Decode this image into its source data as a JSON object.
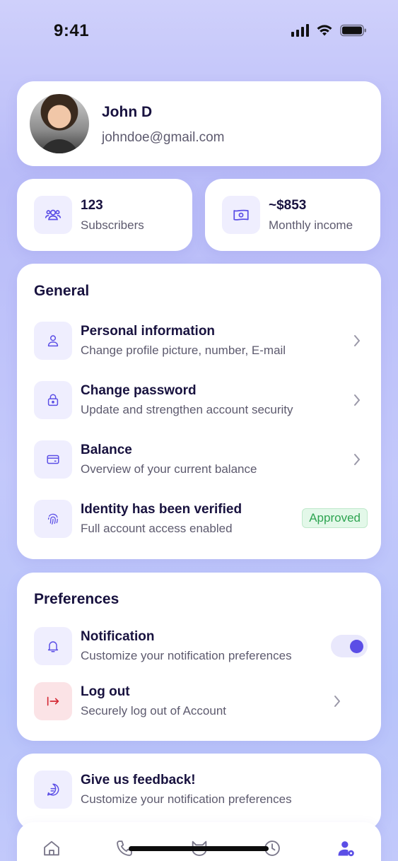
{
  "status_bar": {
    "time": "9:41"
  },
  "profile": {
    "name": "John D",
    "email": "johndoe@gmail.com"
  },
  "stats": [
    {
      "value": "123",
      "label": "Subscribers",
      "icon": "users-icon"
    },
    {
      "value": "~$853",
      "label": "Monthly income",
      "icon": "money-icon"
    }
  ],
  "general": {
    "title": "General",
    "items": [
      {
        "title": "Personal information",
        "subtitle": "Change profile picture, number, E-mail",
        "icon": "user-icon"
      },
      {
        "title": "Change password",
        "subtitle": "Update and strengthen account security",
        "icon": "lock-icon"
      },
      {
        "title": "Balance",
        "subtitle": "Overview of your current balance",
        "icon": "wallet-icon"
      },
      {
        "title": "Identity has been verified",
        "subtitle": "Full account access enabled",
        "icon": "fingerprint-icon",
        "badge": "Approved"
      }
    ]
  },
  "preferences": {
    "title": "Preferences",
    "items": [
      {
        "title": "Notification",
        "subtitle": "Customize your notification preferences",
        "icon": "bell-icon",
        "toggle_on": true
      },
      {
        "title": "Log out",
        "subtitle": "Securely log out of Account",
        "icon": "logout-icon"
      }
    ]
  },
  "feedback": {
    "title": "Give us feedback!",
    "subtitle": "Customize your notification preferences",
    "icon": "chat-icon"
  },
  "tabbar": {
    "tabs": [
      "home-icon",
      "phone-icon",
      "cat-icon",
      "clock-icon",
      "user-settings-icon"
    ],
    "active": "user-settings-icon"
  },
  "colors": {
    "accent": "#5b4ee6",
    "approved": "#2ea451",
    "logout": "#d42a35",
    "text": "#18123f",
    "subtext": "#5d5a6e"
  }
}
